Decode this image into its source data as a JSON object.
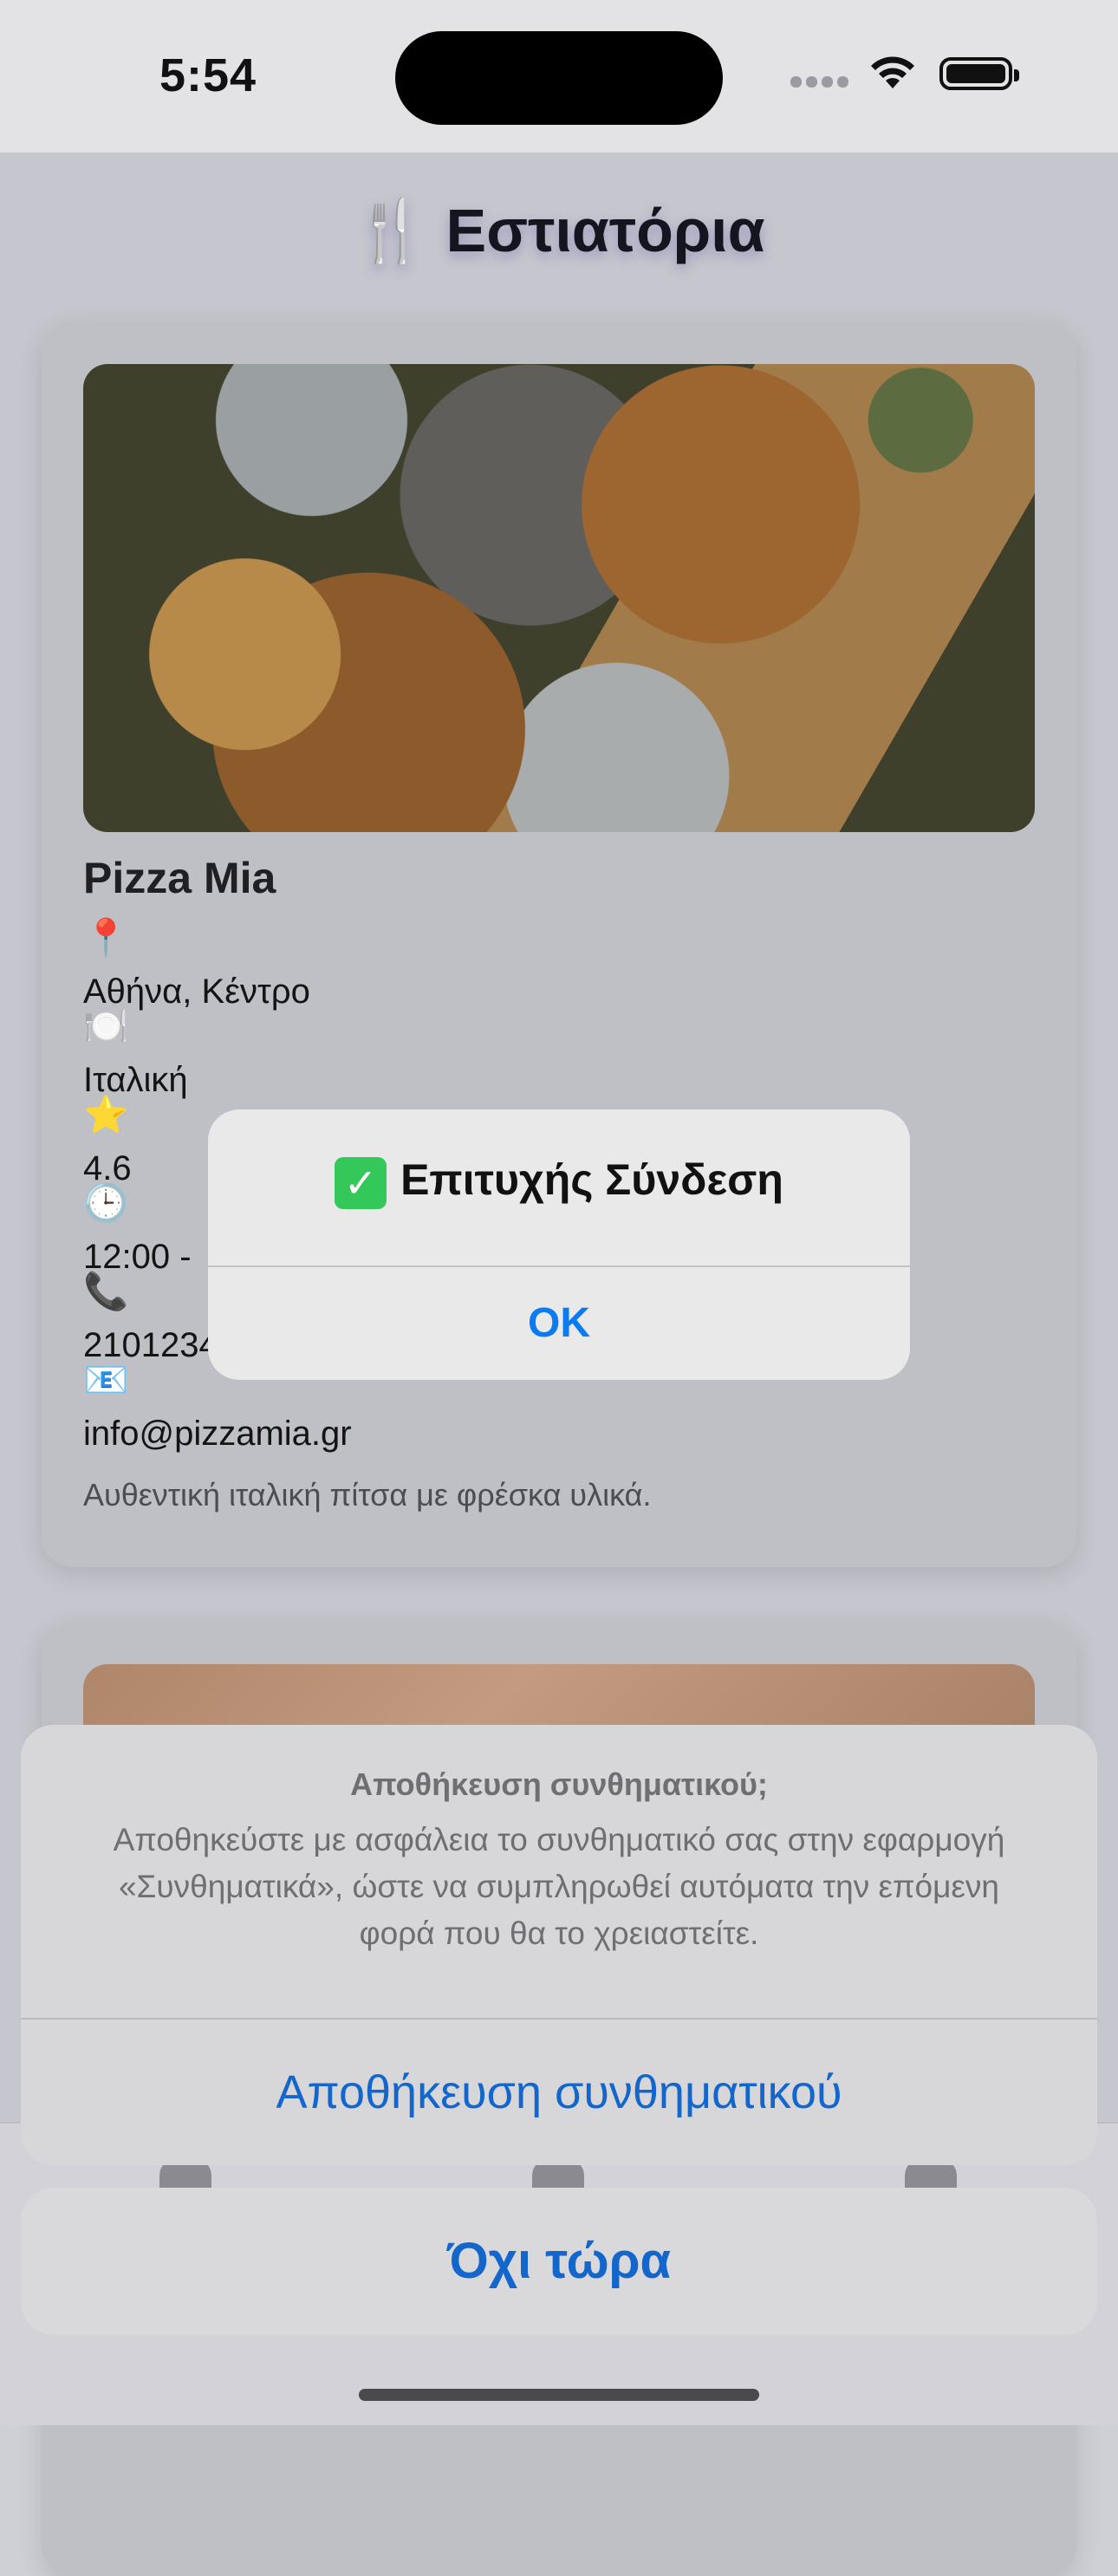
{
  "status_bar": {
    "time": "5:54"
  },
  "header": {
    "icon": "🍴",
    "title": "Εστιατόρια"
  },
  "restaurant": {
    "name": "Pizza Mia",
    "location_icon": "📍",
    "location": "Αθήνα, Κέντρο",
    "cuisine_icon": "🍽️",
    "cuisine": "Ιταλική",
    "rating_icon": "⭐",
    "rating": "4.6",
    "hours_icon": "🕒",
    "hours": "12:00 -",
    "phone_icon": "📞",
    "phone": "2101234",
    "email_icon": "📧",
    "email": "info@pizzamia.gr",
    "description": "Αυθεντική ιταλική πίτσα με φρέσκα υλικά."
  },
  "alert": {
    "check_icon": "✓",
    "title": "Επιτυχής Σύνδεση",
    "ok_label": "OK"
  },
  "save_password_sheet": {
    "title": "Αποθήκευση συνθηματικού;",
    "message": "Αποθηκεύστε με ασφάλεια το συνθηματικό σας στην εφαρμογή «Συνθηματικά», ώστε να συμπληρωθεί αυτόματα την επόμενη φορά που θα το χρειαστείτε.",
    "save_label": "Αποθήκευση συνθηματικού",
    "cancel_label": "Όχι τώρα"
  },
  "colors": {
    "accent": "#0a7bf0",
    "sheet_action": "#1366cc",
    "success": "#34c759"
  }
}
